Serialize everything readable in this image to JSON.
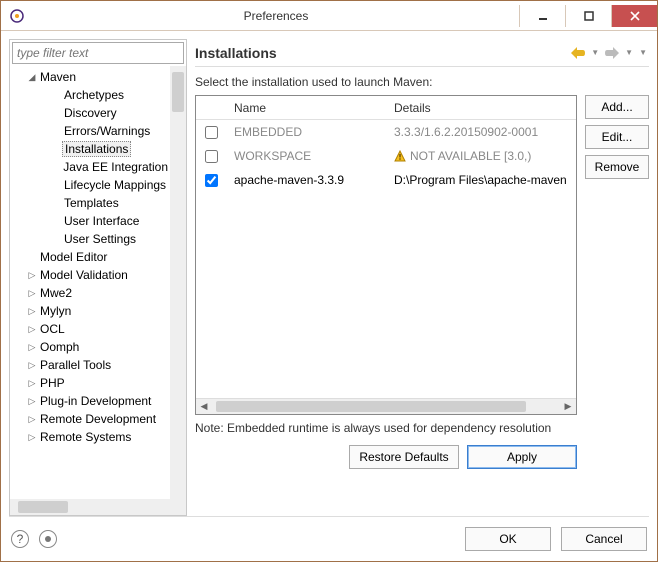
{
  "window": {
    "title": "Preferences"
  },
  "filter": {
    "placeholder": "type filter text"
  },
  "tree": {
    "items": [
      {
        "label": "Maven",
        "twist": "◢",
        "indent": 1
      },
      {
        "label": "Archetypes",
        "twist": "",
        "indent": 2
      },
      {
        "label": "Discovery",
        "twist": "",
        "indent": 2
      },
      {
        "label": "Errors/Warnings",
        "twist": "",
        "indent": 2
      },
      {
        "label": "Installations",
        "twist": "",
        "indent": 2,
        "selected": true
      },
      {
        "label": "Java EE Integration",
        "twist": "",
        "indent": 2
      },
      {
        "label": "Lifecycle Mappings",
        "twist": "",
        "indent": 2
      },
      {
        "label": "Templates",
        "twist": "",
        "indent": 2
      },
      {
        "label": "User Interface",
        "twist": "",
        "indent": 2
      },
      {
        "label": "User Settings",
        "twist": "",
        "indent": 2
      },
      {
        "label": "Model Editor",
        "twist": "",
        "indent": 1
      },
      {
        "label": "Model Validation",
        "twist": "▷",
        "indent": 1
      },
      {
        "label": "Mwe2",
        "twist": "▷",
        "indent": 1
      },
      {
        "label": "Mylyn",
        "twist": "▷",
        "indent": 1
      },
      {
        "label": "OCL",
        "twist": "▷",
        "indent": 1
      },
      {
        "label": "Oomph",
        "twist": "▷",
        "indent": 1
      },
      {
        "label": "Parallel Tools",
        "twist": "▷",
        "indent": 1
      },
      {
        "label": "PHP",
        "twist": "▷",
        "indent": 1
      },
      {
        "label": "Plug-in Development",
        "twist": "▷",
        "indent": 1
      },
      {
        "label": "Remote Development",
        "twist": "▷",
        "indent": 1
      },
      {
        "label": "Remote Systems",
        "twist": "▷",
        "indent": 1
      }
    ]
  },
  "page": {
    "title": "Installations",
    "description": "Select the installation used to launch Maven:",
    "columns": {
      "name": "Name",
      "details": "Details"
    },
    "rows": [
      {
        "checked": false,
        "disabled": true,
        "name": "EMBEDDED",
        "details": "3.3.3/1.6.2.20150902-0001",
        "warn": false
      },
      {
        "checked": false,
        "disabled": true,
        "name": "WORKSPACE",
        "details": "NOT AVAILABLE [3.0,)",
        "warn": true
      },
      {
        "checked": true,
        "disabled": false,
        "name": "apache-maven-3.3.9",
        "details": "D:\\Program Files\\apache-maven",
        "warn": false
      }
    ],
    "buttons": {
      "add": "Add...",
      "edit": "Edit...",
      "remove": "Remove"
    },
    "note": "Note: Embedded runtime is always used for dependency resolution",
    "restore": "Restore Defaults",
    "apply": "Apply"
  },
  "footer": {
    "ok": "OK",
    "cancel": "Cancel"
  }
}
